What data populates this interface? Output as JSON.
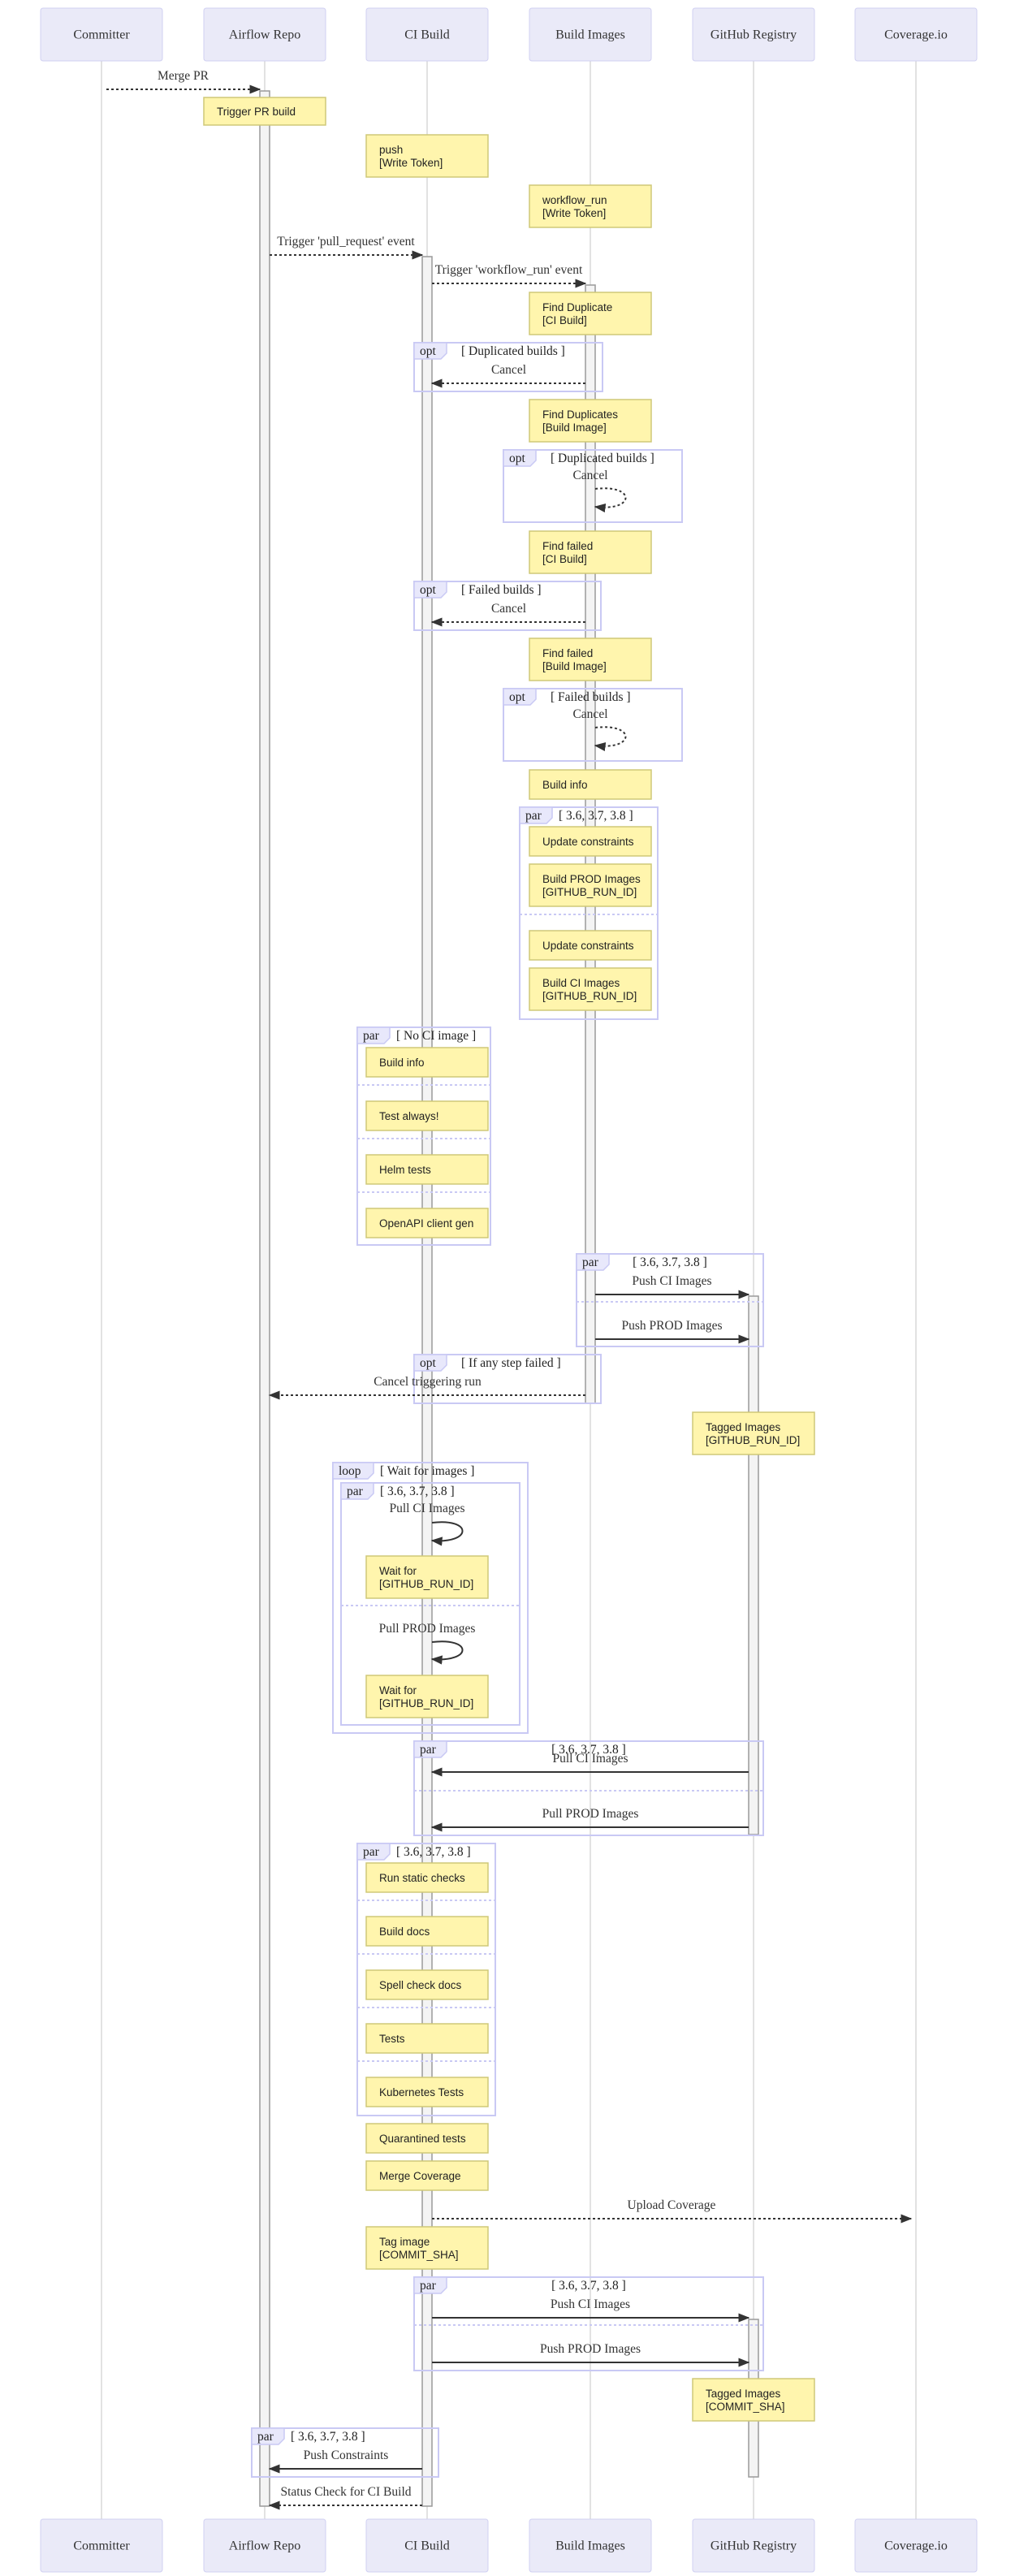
{
  "diagram_type": "sequence",
  "actors": [
    {
      "id": "committer",
      "label": "Committer"
    },
    {
      "id": "repo",
      "label": "Airflow Repo"
    },
    {
      "id": "ci",
      "label": "CI Build"
    },
    {
      "id": "images",
      "label": "Build Images"
    },
    {
      "id": "registry",
      "label": "GitHub Registry"
    },
    {
      "id": "coverage",
      "label": "Coverage.io"
    }
  ],
  "colors": {
    "actor_fill": "#eaeaf8",
    "note_fill": "#fff5ad",
    "frame_stroke": "#c9c9f4",
    "arrow": "#333333"
  },
  "steps": [
    {
      "kind": "message",
      "from": "committer",
      "to": "repo",
      "label": "Merge PR",
      "style": "dotted"
    },
    {
      "kind": "note",
      "over": "repo",
      "lines": [
        "Trigger PR build"
      ]
    },
    {
      "kind": "note",
      "over": "ci",
      "lines": [
        "push",
        "[Write Token]"
      ]
    },
    {
      "kind": "note",
      "over": "images",
      "lines": [
        "workflow_run",
        "[Write Token]"
      ]
    },
    {
      "kind": "message",
      "from": "repo",
      "to": "ci",
      "label": "Trigger 'pull_request' event",
      "style": "dotted"
    },
    {
      "kind": "message",
      "from": "ci",
      "to": "images",
      "label": "Trigger 'workflow_run' event",
      "style": "dotted"
    },
    {
      "kind": "note",
      "over": "images",
      "lines": [
        "Find Duplicate",
        "[CI Build]"
      ]
    },
    {
      "kind": "frame",
      "keyword": "opt",
      "condition": "[ Duplicated builds ]",
      "messages": [
        {
          "from": "images",
          "to": "ci",
          "label": "Cancel",
          "style": "dotted"
        }
      ]
    },
    {
      "kind": "note",
      "over": "images",
      "lines": [
        "Find Duplicates",
        "[Build Image]"
      ]
    },
    {
      "kind": "frame",
      "keyword": "opt",
      "condition": "[ Duplicated builds ]",
      "messages": [
        {
          "from": "images",
          "to": "images",
          "label": "Cancel",
          "style": "dotted"
        }
      ]
    },
    {
      "kind": "note",
      "over": "images",
      "lines": [
        "Find failed",
        "[CI Build]"
      ]
    },
    {
      "kind": "frame",
      "keyword": "opt",
      "condition": "[ Failed builds ]",
      "messages": [
        {
          "from": "images",
          "to": "ci",
          "label": "Cancel",
          "style": "dotted"
        }
      ]
    },
    {
      "kind": "note",
      "over": "images",
      "lines": [
        "Find failed",
        "[Build Image]"
      ]
    },
    {
      "kind": "frame",
      "keyword": "opt",
      "condition": "[ Failed builds ]",
      "messages": [
        {
          "from": "images",
          "to": "images",
          "label": "Cancel",
          "style": "dotted"
        }
      ]
    },
    {
      "kind": "note",
      "over": "images",
      "lines": [
        "Build info"
      ]
    },
    {
      "kind": "frame",
      "keyword": "par",
      "condition": "[ 3.6, 3.7, 3.8 ]",
      "notes": [
        [
          "Update constraints"
        ],
        [
          "Build PROD Images",
          "[GITHUB_RUN_ID]"
        ],
        [
          "Update constraints"
        ],
        [
          "Build CI Images",
          "[GITHUB_RUN_ID]"
        ]
      ]
    },
    {
      "kind": "frame",
      "keyword": "par",
      "condition": "[ No CI image ]",
      "notes": [
        [
          "Build info"
        ],
        [
          "Test always!"
        ],
        [
          "Helm tests"
        ],
        [
          "OpenAPI client gen"
        ]
      ]
    },
    {
      "kind": "frame",
      "keyword": "par",
      "condition": "[ 3.6, 3.7, 3.8 ]",
      "messages": [
        {
          "from": "images",
          "to": "registry",
          "label": "Push CI Images",
          "style": "solid"
        },
        {
          "from": "images",
          "to": "registry",
          "label": "Push PROD Images",
          "style": "solid"
        }
      ]
    },
    {
      "kind": "frame",
      "keyword": "opt",
      "condition": "[ If any step failed ]",
      "messages": [
        {
          "from": "images",
          "to": "repo",
          "label": "Cancel triggering run",
          "style": "dotted"
        }
      ]
    },
    {
      "kind": "note",
      "over": "registry",
      "lines": [
        "Tagged Images",
        "[GITHUB_RUN_ID]"
      ]
    },
    {
      "kind": "frame",
      "keyword": "loop",
      "condition": "[ Wait for images ]",
      "inner": {
        "keyword": "par",
        "condition": "[ 3.6, 3.7, 3.8 ]",
        "sections": [
          {
            "self_message": "Pull CI Images",
            "note": [
              "Wait for",
              "[GITHUB_RUN_ID]"
            ]
          },
          {
            "self_message": "Pull PROD Images",
            "note": [
              "Wait for",
              "[GITHUB_RUN_ID]"
            ]
          }
        ]
      }
    },
    {
      "kind": "frame",
      "keyword": "par",
      "condition": "[ 3.6, 3.7, 3.8 ]",
      "messages": [
        {
          "from": "registry",
          "to": "ci",
          "label": "Pull CI Images",
          "style": "solid"
        },
        {
          "from": "registry",
          "to": "ci",
          "label": "Pull PROD Images",
          "style": "solid"
        }
      ]
    },
    {
      "kind": "frame",
      "keyword": "par",
      "condition": "[ 3.6, 3.7, 3.8 ]",
      "notes": [
        [
          "Run static checks"
        ],
        [
          "Build docs"
        ],
        [
          "Spell check docs"
        ],
        [
          "Tests"
        ],
        [
          "Kubernetes Tests"
        ]
      ]
    },
    {
      "kind": "note",
      "over": "ci",
      "lines": [
        "Quarantined tests"
      ]
    },
    {
      "kind": "note",
      "over": "ci",
      "lines": [
        "Merge Coverage"
      ]
    },
    {
      "kind": "message",
      "from": "ci",
      "to": "coverage",
      "label": "Upload Coverage",
      "style": "dotted"
    },
    {
      "kind": "note",
      "over": "ci",
      "lines": [
        "Tag image",
        "[COMMIT_SHA]"
      ]
    },
    {
      "kind": "frame",
      "keyword": "par",
      "condition": "[ 3.6, 3.7, 3.8 ]",
      "messages": [
        {
          "from": "ci",
          "to": "registry",
          "label": "Push CI Images",
          "style": "solid"
        },
        {
          "from": "ci",
          "to": "registry",
          "label": "Push PROD Images",
          "style": "solid"
        }
      ]
    },
    {
      "kind": "note",
      "over": "registry",
      "lines": [
        "Tagged Images",
        "[COMMIT_SHA]"
      ]
    },
    {
      "kind": "frame",
      "keyword": "par",
      "condition": "[ 3.6, 3.7, 3.8 ]",
      "messages": [
        {
          "from": "ci",
          "to": "repo",
          "label": "Push Constraints",
          "style": "solid"
        }
      ]
    },
    {
      "kind": "message",
      "from": "ci",
      "to": "repo",
      "label": "Status Check for CI Build",
      "style": "dotted"
    }
  ]
}
